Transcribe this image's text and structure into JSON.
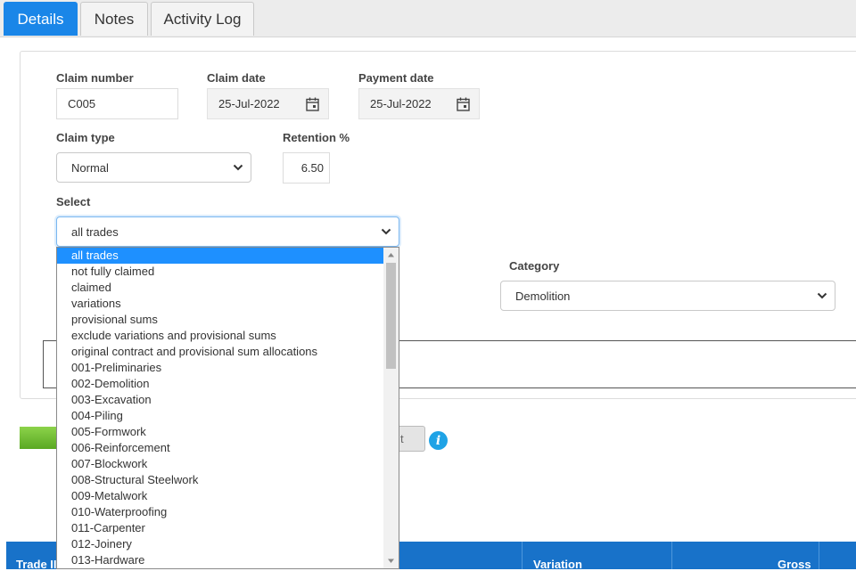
{
  "tabs": [
    {
      "label": "Details",
      "active": true
    },
    {
      "label": "Notes",
      "active": false
    },
    {
      "label": "Activity Log",
      "active": false
    }
  ],
  "form": {
    "claim_number": {
      "label": "Claim number",
      "value": "C005"
    },
    "claim_date": {
      "label": "Claim date",
      "value": "25-Jul-2022"
    },
    "payment_date": {
      "label": "Payment date",
      "value": "25-Jul-2022"
    },
    "claim_type": {
      "label": "Claim type",
      "value": "Normal"
    },
    "retention": {
      "label": "Retention %",
      "value": "6.50"
    },
    "select": {
      "label": "Select",
      "value": "all trades"
    },
    "category": {
      "label": "Category",
      "value": "Demolition"
    }
  },
  "dropdown": {
    "options": [
      "all trades",
      "not fully claimed",
      "claimed",
      "variations",
      "provisional sums",
      "exclude variations and provisional sums",
      "original contract and provisional sum allocations",
      "001-Preliminaries",
      "002-Demolition",
      "003-Excavation",
      "004-Piling",
      "005-Formwork",
      "006-Reinforcement",
      "007-Blockwork",
      "008-Structural Steelwork",
      "009-Metalwork",
      "010-Waterproofing",
      "011-Carpenter",
      "012-Joinery",
      "013-Hardware"
    ],
    "selected_index": 0
  },
  "partial_button_text": "t",
  "info_icon": "i",
  "table_header": {
    "trade": "Trade II",
    "variation": "Variation",
    "gross": "Gross"
  },
  "colors": {
    "accent": "#1a86e8",
    "header": "#1872c9",
    "selected_option": "#1e90ff",
    "green": "#6cbf2e"
  }
}
